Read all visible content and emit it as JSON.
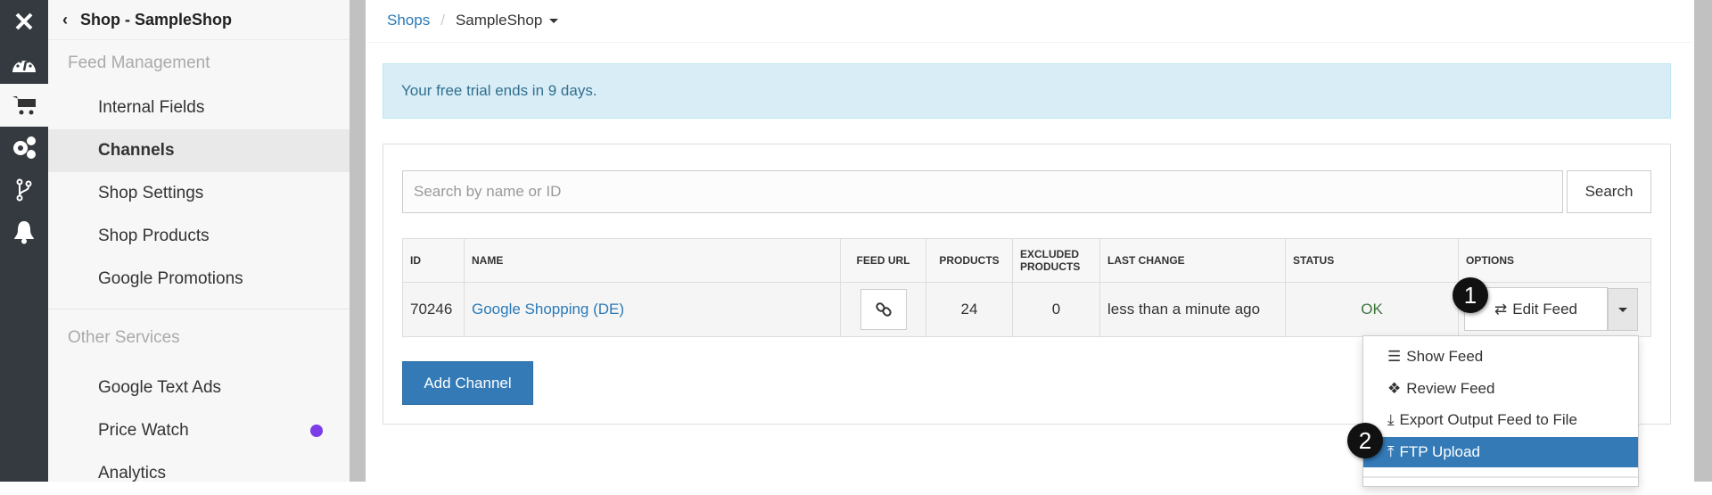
{
  "rail": {
    "icons": [
      "close-icon",
      "dashboard-icon",
      "cart-icon",
      "cogs-icon",
      "branch-icon",
      "bell-icon"
    ]
  },
  "sidebar": {
    "title": "Shop - SampleShop",
    "section1": "Feed Management",
    "items1": [
      {
        "label": "Internal Fields"
      },
      {
        "label": "Channels"
      },
      {
        "label": "Shop Settings"
      },
      {
        "label": "Shop Products"
      },
      {
        "label": "Google Promotions"
      }
    ],
    "section2": "Other Services",
    "items2": [
      {
        "label": "Google Text Ads"
      },
      {
        "label": "Price Watch"
      },
      {
        "label": "Analytics"
      }
    ],
    "active": "Channels",
    "dot_color": "#7a3de8"
  },
  "breadcrumb": {
    "root": "Shops",
    "current": "SampleShop"
  },
  "alert": {
    "text": "Your free trial ends in 9 days."
  },
  "search": {
    "placeholder": "Search by name or ID",
    "value": "",
    "button": "Search"
  },
  "table": {
    "headers": [
      "ID",
      "NAME",
      "FEED URL",
      "PRODUCTS",
      "EXCLUDED PRODUCTS",
      "LAST CHANGE",
      "STATUS",
      "OPTIONS"
    ],
    "rows": [
      {
        "id": "70246",
        "name": "Google Shopping (DE)",
        "products": "24",
        "excluded": "0",
        "last_change": "less than a minute ago",
        "status": "OK",
        "option": "Edit Feed"
      }
    ]
  },
  "add_channel": "Add Channel",
  "dropdown": {
    "items": [
      {
        "label": "Show Feed"
      },
      {
        "label": "Review Feed"
      },
      {
        "label": "Export Output Feed to File"
      },
      {
        "label": "FTP Upload"
      }
    ],
    "highlighted": "FTP Upload"
  },
  "badges": [
    "1",
    "2"
  ],
  "colors": {
    "primary": "#337ab7",
    "rail": "#343a40",
    "alert_bg": "#d9edf7",
    "ok": "#3c763d"
  }
}
